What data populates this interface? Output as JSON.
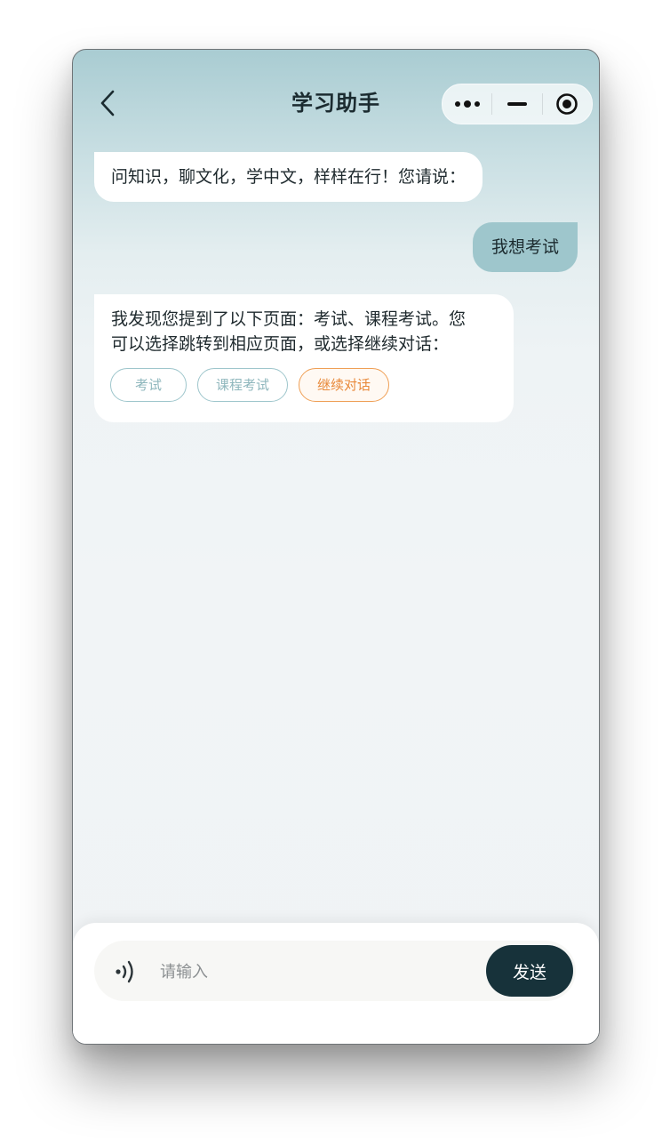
{
  "header": {
    "title": "学习助手",
    "back_icon": "chevron-left-icon",
    "capsule": {
      "more_icon": "more-dots-icon",
      "minimize_icon": "minimize-icon",
      "close_icon": "target-circle-icon"
    }
  },
  "messages": [
    {
      "role": "assistant",
      "text": "问知识，聊文化，学中文，样样在行！您请说："
    },
    {
      "role": "user",
      "text": "我想考试"
    },
    {
      "role": "assistant",
      "lines": [
        "我发现您提到了以下页面：考试、课程考试。您",
        "可以选择跳转到相应页面，或选择继续对话："
      ],
      "options": [
        "考试",
        "课程考试",
        "继续对话"
      ]
    }
  ],
  "composer": {
    "voice_icon": "voice-wave-icon",
    "placeholder": "请输入",
    "value": "",
    "send_label": "发送"
  },
  "colors": {
    "accent_teal": "#9ec6cc",
    "accent_orange": "#ef9f55",
    "send_bg": "#17323a",
    "title": "#1b2b30"
  }
}
